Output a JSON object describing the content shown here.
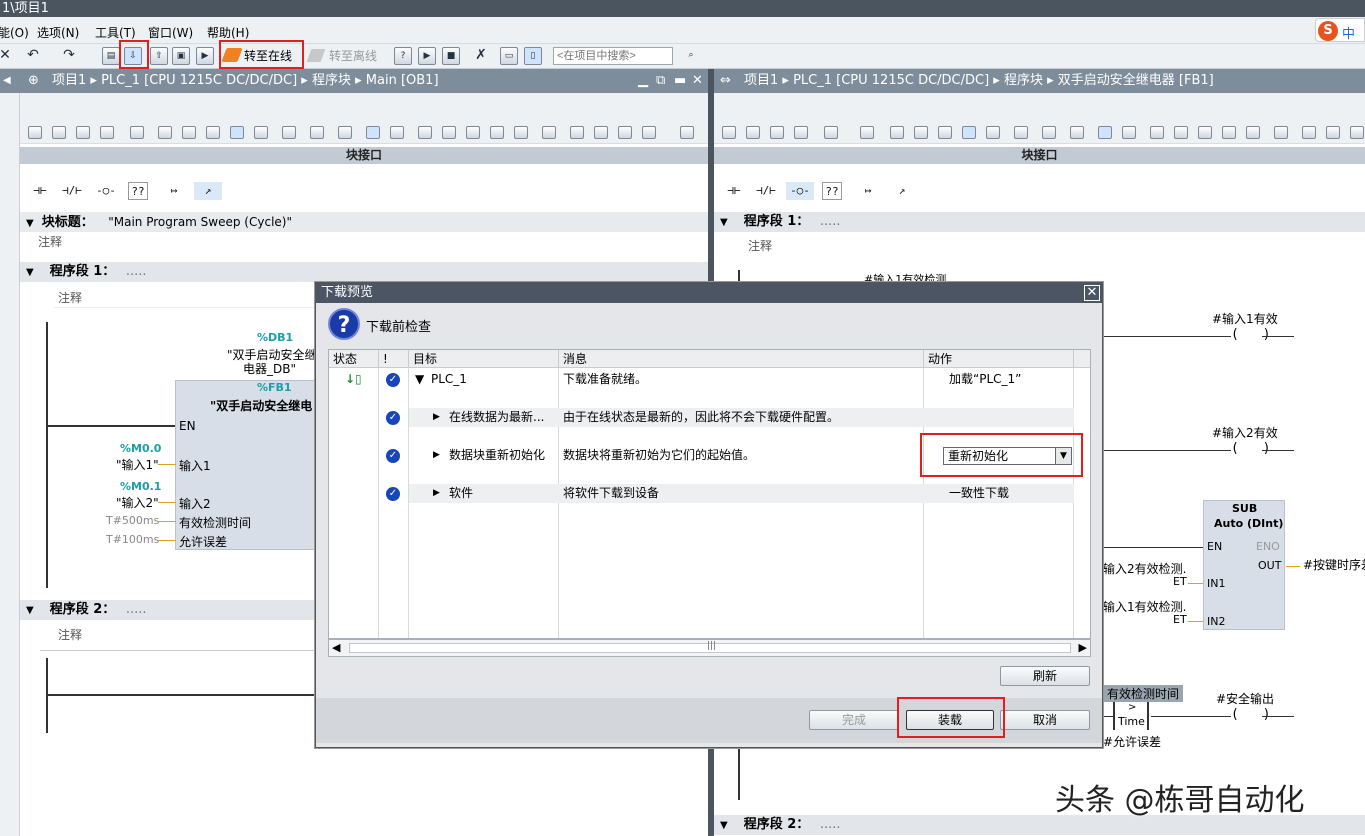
{
  "window": {
    "title": "1\\项目1"
  },
  "menu": {
    "items": [
      "能(O)",
      "选项(N)",
      "工具(T)",
      "窗口(W)",
      "帮助(H)"
    ]
  },
  "ime": {
    "label": "中"
  },
  "toolbar": {
    "go_online": "转至在线",
    "go_offline": "转至离线",
    "search_placeholder": "<在项目中搜索>"
  },
  "left_panel": {
    "breadcrumb": [
      "项目1",
      "PLC_1 [CPU 1215C DC/DC/DC]",
      "程序块",
      "Main [OB1]"
    ],
    "interface_label": "块接口",
    "block_title_label": "块标题：",
    "block_title_value": "\"Main Program Sweep (Cycle)\"",
    "comment": "注释",
    "seg1": {
      "label": "程序段 1：",
      "dots": "....."
    },
    "seg2": {
      "label": "程序段 2：",
      "dots": "....."
    },
    "db_addr": "%DB1",
    "db_name_line1": "\"双手启动安全继",
    "db_name_line2": "电器_DB\"",
    "fb_addr": "%FB1",
    "fb_name": "\"双手启动安全继电",
    "pins": {
      "en": "EN",
      "in1": "输入1",
      "in2": "输入2",
      "t1": "有效检测时间",
      "t2": "允许误差"
    },
    "m0": "%M0.0",
    "m0_name": "\"输入1\"",
    "m1": "%M0.1",
    "m1_name": "\"输入2\"",
    "t500": "T#500ms",
    "t100": "T#100ms"
  },
  "right_panel": {
    "breadcrumb": [
      "项目1",
      "PLC_1 [CPU 1215C DC/DC/DC]",
      "程序块",
      "双手启动安全继电器 [FB1]"
    ],
    "interface_label": "块接口",
    "comment": "注释",
    "seg1": {
      "label": "程序段 1：",
      "dots": "....."
    },
    "seg2": {
      "label": "程序段 2：",
      "dots": "....."
    },
    "top_label": "#输入1有效检测",
    "coil1": "#输入1有效",
    "coil2": "#输入2有效",
    "sub_title": "SUB",
    "sub_type": "Auto (DInt)",
    "sub_en": "EN",
    "sub_eno": "ENO",
    "sub_out": "OUT",
    "sub_in1": "IN1",
    "sub_in2": "IN2",
    "out_target": "#按键时序差",
    "in1_src": "输入2有效检测.",
    "in1_et": "ET",
    "in2_src": "输入1有效检测.",
    "in2_et": "ET",
    "cmp_src": "有效检测时间",
    "cmp_op": ">",
    "cmp_type": "Time",
    "cmp_ref": "#允许误差",
    "coil3": "#安全输出"
  },
  "dialog": {
    "title": "下载预览",
    "heading": "下载前检查",
    "columns": [
      "状态",
      "!",
      "目标",
      "消息",
      "动作"
    ],
    "rows": [
      {
        "target": "PLC_1",
        "message": "下载准备就绪。",
        "action": "加载“PLC_1”"
      },
      {
        "target": "在线数据为最新...",
        "message": "由于在线状态是最新的，因此将不会下载硬件配置。",
        "action": ""
      },
      {
        "target": "数据块重新初始化",
        "message": "数据块将重新初始为它们的起始值。",
        "action": "重新初始化"
      },
      {
        "target": "软件",
        "message": "将软件下载到设备",
        "action": "一致性下载"
      }
    ],
    "refresh": "刷新",
    "finish": "完成",
    "load": "装载",
    "cancel": "取消"
  },
  "watermark": "头条 @栋哥自动化",
  "colors": {
    "highlight_red": "#e02020",
    "check_blue": "#1646b8",
    "teal": "#1aa0a6"
  }
}
